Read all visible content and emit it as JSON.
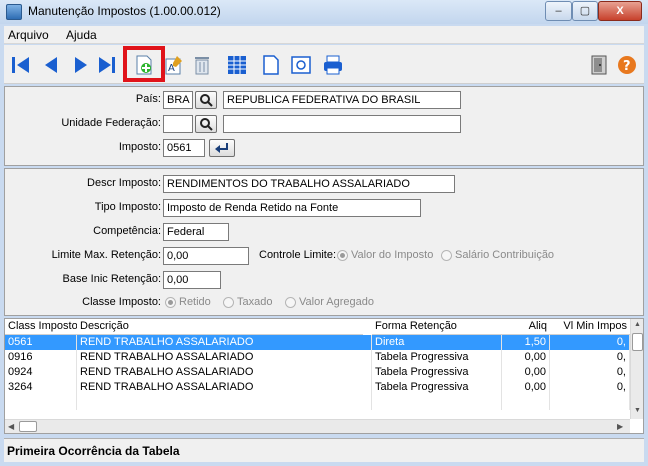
{
  "window": {
    "title": "Manutenção Impostos (1.00.00.012)",
    "min": "–",
    "max": "▢",
    "close": "X"
  },
  "menu": {
    "arquivo": "Arquivo",
    "ajuda": "Ajuda"
  },
  "form": {
    "pais_label": "País:",
    "pais_code": "BRA",
    "pais_name": "REPUBLICA FEDERATIVA DO BRASIL",
    "uf_label": "Unidade Federação:",
    "uf_code": "",
    "uf_name": "",
    "imposto_label": "Imposto:",
    "imposto_value": "0561",
    "descr_label": "Descr Imposto:",
    "descr_value": "RENDIMENTOS DO TRABALHO ASSALARIADO",
    "tipo_label": "Tipo Imposto:",
    "tipo_value": "Imposto de Renda Retido na Fonte",
    "competencia_label": "Competência:",
    "competencia_value": "Federal",
    "limite_label": "Limite Max. Retenção:",
    "limite_value": "0,00",
    "controle_label": "Controle Limite:",
    "controle_opt1": "Valor do Imposto",
    "controle_opt2": "Salário Contribuição",
    "base_label": "Base Inic Retenção:",
    "base_value": "0,00",
    "classe_label": "Classe Imposto:",
    "classe_opt1": "Retido",
    "classe_opt2": "Taxado",
    "classe_opt3": "Valor Agregado"
  },
  "grid": {
    "headers": [
      "Class Imposto",
      "Descrição",
      "Forma Retenção",
      "Aliq",
      "Vl Min Impos"
    ],
    "rows": [
      [
        "0561",
        "REND TRABALHO ASSALARIADO",
        "Direta",
        "1,50",
        "0,"
      ],
      [
        "0916",
        "REND TRABALHO ASSALARIADO",
        "Tabela Progressiva",
        "0,00",
        "0,"
      ],
      [
        "0924",
        "REND TRABALHO ASSALARIADO",
        "Tabela Progressiva",
        "0,00",
        "0,"
      ],
      [
        "3264",
        "REND TRABALHO ASSALARIADO",
        "Tabela Progressiva",
        "0,00",
        "0,"
      ]
    ]
  },
  "status": {
    "text": "Primeira Ocorrência da Tabela"
  },
  "colors": {
    "accent": "#3399ff",
    "highlight": "#e0131a",
    "nav": "#1a5fd0"
  }
}
